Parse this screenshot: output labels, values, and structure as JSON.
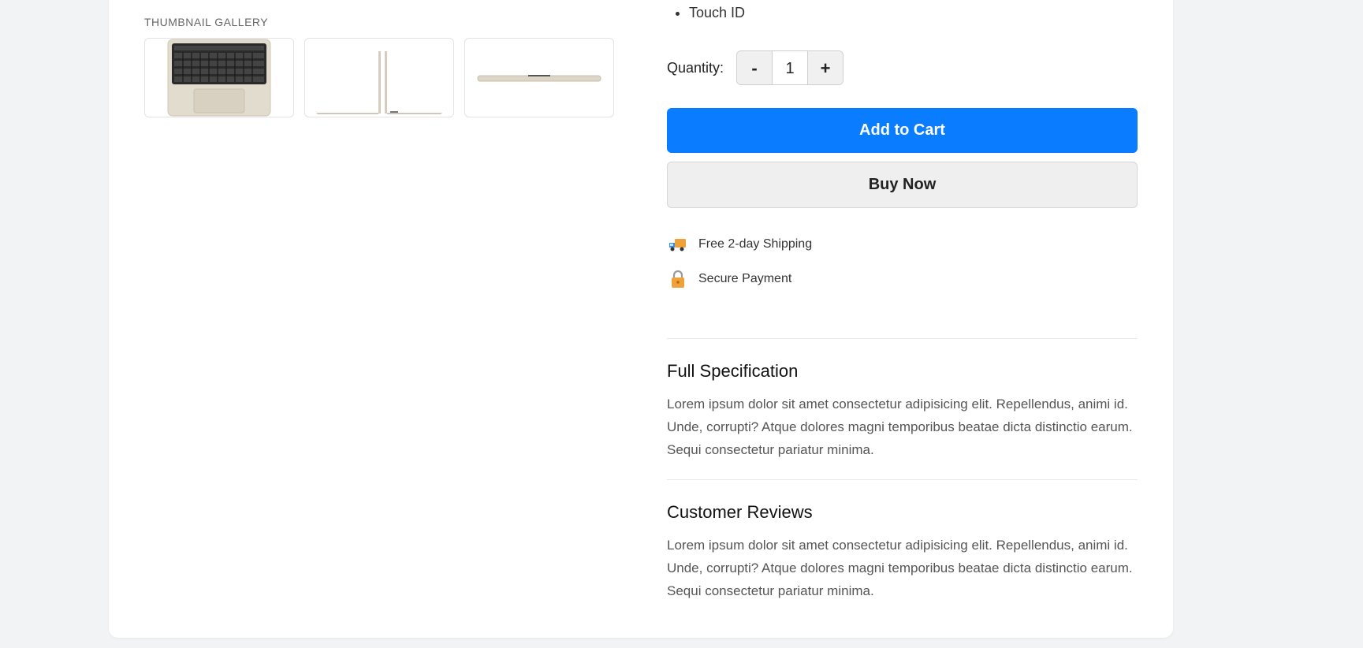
{
  "gallery": {
    "heading": "THUMBNAIL GALLERY",
    "thumbnails": [
      {
        "alt": "laptop-top-view"
      },
      {
        "alt": "laptop-open-side-view"
      },
      {
        "alt": "laptop-closed-side-view"
      }
    ]
  },
  "features": {
    "items": [
      "Touch ID"
    ]
  },
  "quantity": {
    "label": "Quantity:",
    "decrement_label": "-",
    "value": "1",
    "increment_label": "+"
  },
  "actions": {
    "add_to_cart": "Add to Cart",
    "buy_now": "Buy Now"
  },
  "perks": [
    {
      "icon": "truck-icon",
      "label": "Free 2-day Shipping"
    },
    {
      "icon": "lock-icon",
      "label": "Secure Payment"
    }
  ],
  "sections": {
    "specification": {
      "title": "Full Specification",
      "body": "Lorem ipsum dolor sit amet consectetur adipisicing elit. Repellendus, animi id. Unde, corrupti? Atque dolores magni temporibus beatae dicta distinctio earum. Sequi consectetur pariatur minima."
    },
    "reviews": {
      "title": "Customer Reviews",
      "body": "Lorem ipsum dolor sit amet consectetur adipisicing elit. Repellendus, animi id. Unde, corrupti? Atque dolores magni temporibus beatae dicta distinctio earum. Sequi consectetur pariatur minima."
    }
  },
  "colors": {
    "primary": "#0a7cff",
    "secondary_bg": "#efefef",
    "page_bg": "#f2f3f5"
  }
}
